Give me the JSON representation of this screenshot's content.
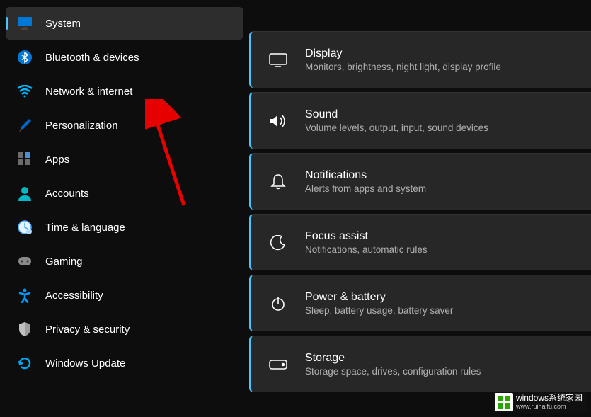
{
  "sidebar": {
    "items": [
      {
        "label": "System",
        "icon": "monitor",
        "icon_color": "#0078d4",
        "selected": true
      },
      {
        "label": "Bluetooth & devices",
        "icon": "bluetooth",
        "icon_color": "#0078d4",
        "selected": false
      },
      {
        "label": "Network & internet",
        "icon": "wifi",
        "icon_color": "#00b7ff",
        "selected": false
      },
      {
        "label": "Personalization",
        "icon": "brush",
        "icon_color": "#c55a11",
        "selected": false
      },
      {
        "label": "Apps",
        "icon": "apps",
        "icon_color": "#8e8e8e",
        "selected": false
      },
      {
        "label": "Accounts",
        "icon": "person",
        "icon_color": "#00b7c3",
        "selected": false
      },
      {
        "label": "Time & language",
        "icon": "clock-globe",
        "icon_color": "#4da6ff",
        "selected": false
      },
      {
        "label": "Gaming",
        "icon": "gamepad",
        "icon_color": "#8a8a8a",
        "selected": false
      },
      {
        "label": "Accessibility",
        "icon": "accessibility",
        "icon_color": "#0099ff",
        "selected": false
      },
      {
        "label": "Privacy & security",
        "icon": "shield",
        "icon_color": "#9e9e9e",
        "selected": false
      },
      {
        "label": "Windows Update",
        "icon": "update",
        "icon_color": "#00a4ef",
        "selected": false
      }
    ]
  },
  "main": {
    "cards": [
      {
        "title": "Display",
        "subtitle": "Monitors, brightness, night light, display profile",
        "icon": "display"
      },
      {
        "title": "Sound",
        "subtitle": "Volume levels, output, input, sound devices",
        "icon": "sound"
      },
      {
        "title": "Notifications",
        "subtitle": "Alerts from apps and system",
        "icon": "bell"
      },
      {
        "title": "Focus assist",
        "subtitle": "Notifications, automatic rules",
        "icon": "moon"
      },
      {
        "title": "Power & battery",
        "subtitle": "Sleep, battery usage, battery saver",
        "icon": "power"
      },
      {
        "title": "Storage",
        "subtitle": "Storage space, drives, configuration rules",
        "icon": "storage"
      }
    ]
  },
  "annotation": {
    "arrow_color": "#e60000"
  },
  "watermark": {
    "brand": "windows系统家园",
    "url": "www.ruihaifu.com"
  }
}
